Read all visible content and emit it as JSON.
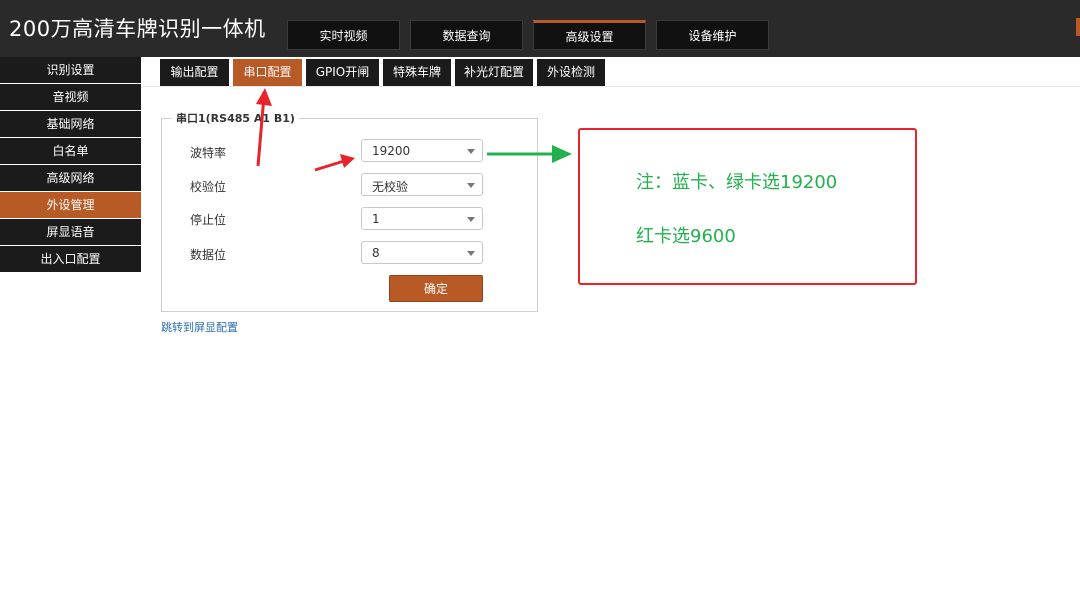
{
  "header": {
    "title": "200万高清车牌识别一体机",
    "nav": [
      "实时视频",
      "数据查询",
      "高级设置",
      "设备维护"
    ],
    "active_nav": "高级设置",
    "accent_color": "#b75a25"
  },
  "sidebar": {
    "items": [
      {
        "label": "识别设置"
      },
      {
        "label": "音视频"
      },
      {
        "label": "基础网络"
      },
      {
        "label": "白名单"
      },
      {
        "label": "高级网络"
      },
      {
        "label": "外设管理",
        "active": true
      },
      {
        "label": "屏显语音"
      },
      {
        "label": "出入口配置"
      }
    ]
  },
  "tabs": [
    {
      "label": "输出配置"
    },
    {
      "label": "串口配置",
      "active": true
    },
    {
      "label": "GPIO开闸"
    },
    {
      "label": "特殊车牌"
    },
    {
      "label": "补光灯配置"
    },
    {
      "label": "外设检测"
    }
  ],
  "serial_form": {
    "legend": "串口1(RS485 A1 B1)",
    "fields": [
      {
        "label": "波特率",
        "value": "19200"
      },
      {
        "label": "校验位",
        "value": "无校验"
      },
      {
        "label": "停止位",
        "value": "1"
      },
      {
        "label": "数据位",
        "value": "8"
      }
    ],
    "confirm_label": "确定"
  },
  "jump_link": "跳转到屏显配置",
  "annotation": {
    "lines": [
      "注：蓝卡、绿卡选19200",
      "红卡选9600"
    ],
    "box_color": "#e8232b",
    "text_color": "#22b14c",
    "arrow_colors": {
      "red": "#e8232b",
      "green": "#22b14c"
    }
  },
  "icons": [
    "select-caret-icon",
    "annotation-arrow-icon"
  ]
}
